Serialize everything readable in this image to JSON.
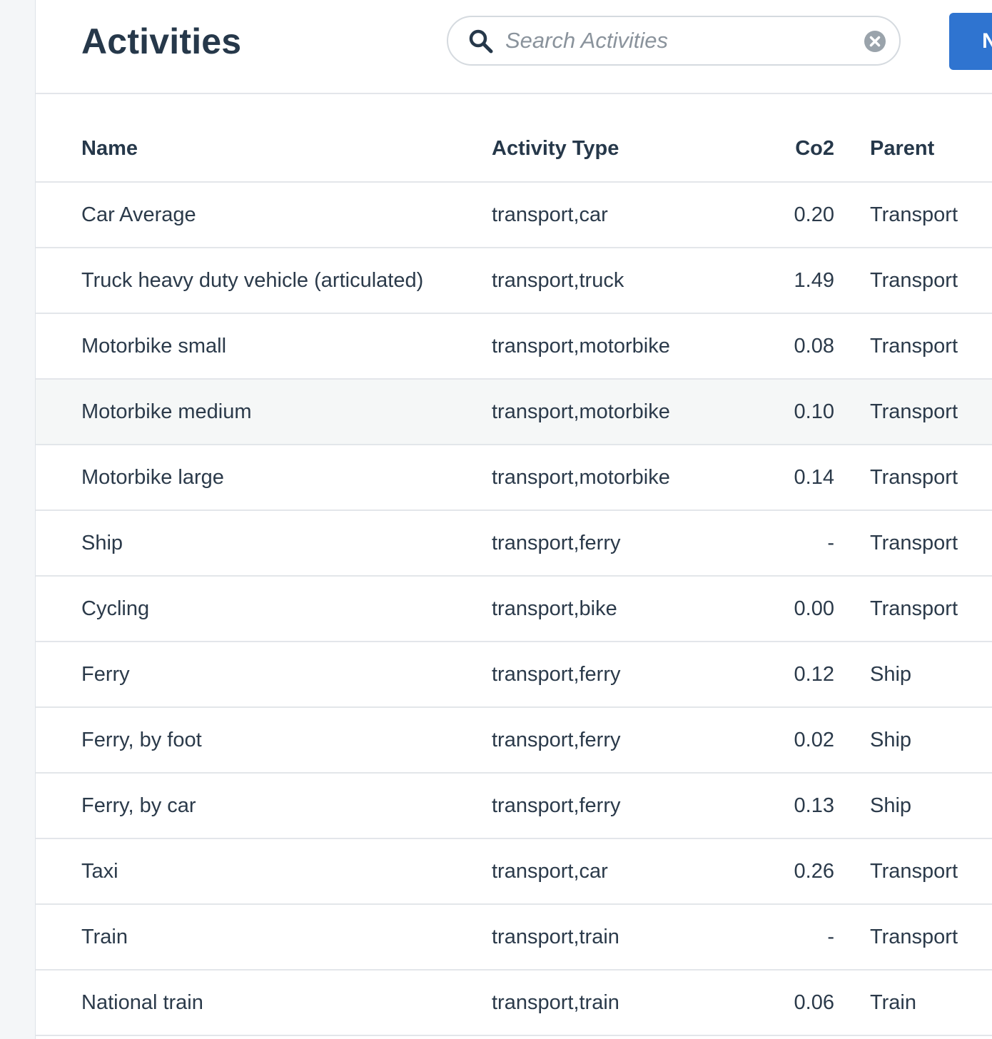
{
  "header": {
    "title": "Activities",
    "search_placeholder": "Search Activities",
    "search_value": "",
    "new_button_label": "N"
  },
  "table": {
    "columns": {
      "name": "Name",
      "activity_type": "Activity Type",
      "co2": "Co2",
      "parent": "Parent"
    },
    "rows": [
      {
        "name": "Car Average",
        "type": "transport,car",
        "co2": "0.20",
        "parent": "Transport"
      },
      {
        "name": "Truck heavy duty vehicle (articulated)",
        "type": "transport,truck",
        "co2": "1.49",
        "parent": "Transport"
      },
      {
        "name": "Motorbike small",
        "type": "transport,motorbike",
        "co2": "0.08",
        "parent": "Transport"
      },
      {
        "name": "Motorbike medium",
        "type": "transport,motorbike",
        "co2": "0.10",
        "parent": "Transport"
      },
      {
        "name": "Motorbike large",
        "type": "transport,motorbike",
        "co2": "0.14",
        "parent": "Transport"
      },
      {
        "name": "Ship",
        "type": "transport,ferry",
        "co2": "-",
        "parent": "Transport"
      },
      {
        "name": "Cycling",
        "type": "transport,bike",
        "co2": "0.00",
        "parent": "Transport"
      },
      {
        "name": "Ferry",
        "type": "transport,ferry",
        "co2": "0.12",
        "parent": "Ship"
      },
      {
        "name": "Ferry, by foot",
        "type": "transport,ferry",
        "co2": "0.02",
        "parent": "Ship"
      },
      {
        "name": "Ferry, by car",
        "type": "transport,ferry",
        "co2": "0.13",
        "parent": "Ship"
      },
      {
        "name": "Taxi",
        "type": "transport,car",
        "co2": "0.26",
        "parent": "Transport"
      },
      {
        "name": "Train",
        "type": "transport,train",
        "co2": "-",
        "parent": "Transport"
      },
      {
        "name": "National train",
        "type": "transport,train",
        "co2": "0.06",
        "parent": "Train"
      }
    ]
  },
  "icons": {
    "search": "search-icon",
    "clear": "clear-icon"
  },
  "colors": {
    "accent": "#2f74d0",
    "hover_row": "#f5f7f7",
    "text": "#2b3a4a"
  }
}
